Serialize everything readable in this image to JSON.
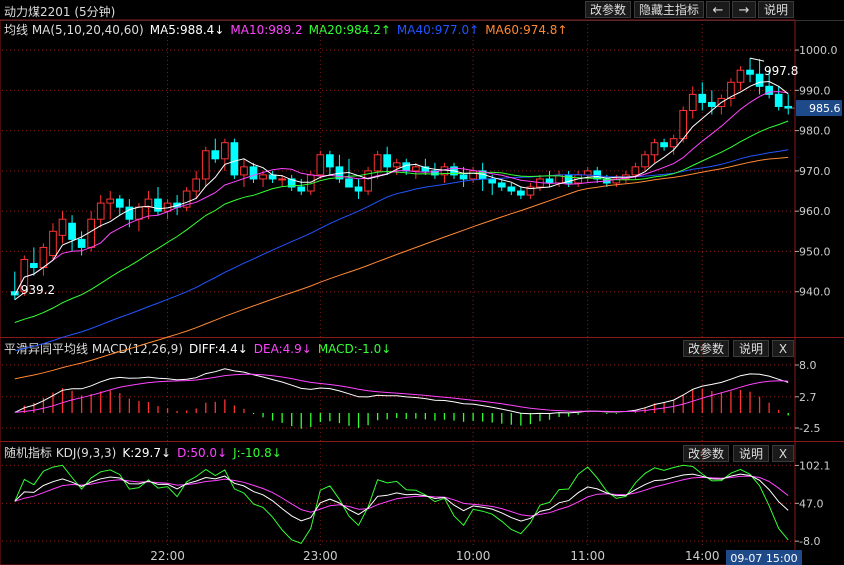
{
  "window": {
    "title": "动力煤2201 (5分钟)",
    "buttons": {
      "change_params": "改参数",
      "hide_indicator": "隐藏主指标",
      "back": "←",
      "forward": "→",
      "help": "说明",
      "close": "X"
    }
  },
  "main_legend": {
    "label": "均线 MA(5,10,20,40,60)",
    "ma5": "MA5:988.4↓",
    "ma10": "MA10:989.2",
    "ma20": "MA20:984.2↑",
    "ma40": "MA40:977.0↑",
    "ma60": "MA60:974.8↑"
  },
  "macd_legend": {
    "label": "平滑异同平均线 MACD(12,26,9)",
    "diff": "DIFF:4.4↓",
    "dea": "DEA:4.9↓",
    "macd": "MACD:-1.0↓"
  },
  "kdj_legend": {
    "label": "随机指标 KDJ(9,3,3)",
    "k": "K:29.7↓",
    "d": "D:50.0↓",
    "j": "J:-10.8↓"
  },
  "annotations": {
    "high_label": "997.8",
    "low_label": "939.2",
    "last_price": "985.6",
    "time_cursor": "09-07 15:00"
  },
  "colors": {
    "up": "#ff3232",
    "down": "#00ffff",
    "ma5": "#ffffff",
    "ma10": "#ff44ff",
    "ma20": "#33ff33",
    "ma40": "#2255ff",
    "ma60": "#ff8833",
    "grid": "#8a1a1a"
  },
  "chart_data": [
    {
      "type": "candlestick",
      "yticks": [
        1000,
        990,
        980,
        970,
        960,
        950,
        940
      ],
      "ylim": [
        929,
        1003
      ],
      "xlabels": [
        "22:00",
        "23:00",
        "10:00",
        "11:00",
        "14:00"
      ],
      "candles": [
        [
          940,
          945,
          938,
          939.2
        ],
        [
          940,
          949,
          939,
          948
        ],
        [
          947,
          951,
          944,
          946
        ],
        [
          946,
          952,
          944,
          951
        ],
        [
          949,
          957,
          948,
          955
        ],
        [
          954,
          960,
          952,
          958
        ],
        [
          957,
          959,
          950,
          953
        ],
        [
          953,
          955,
          949,
          951
        ],
        [
          951,
          960,
          950,
          958
        ],
        [
          958,
          964,
          956,
          962
        ],
        [
          962,
          965,
          958,
          963
        ],
        [
          963,
          964,
          959,
          961
        ],
        [
          961,
          963,
          956,
          958
        ],
        [
          958,
          962,
          955,
          961
        ],
        [
          961,
          965,
          958,
          963
        ],
        [
          963,
          966,
          959,
          960
        ],
        [
          960,
          963,
          958,
          962
        ],
        [
          962,
          964,
          959,
          961
        ],
        [
          961,
          966,
          960,
          965
        ],
        [
          965,
          970,
          963,
          968
        ],
        [
          968,
          976,
          966,
          975
        ],
        [
          975,
          978,
          972,
          973
        ],
        [
          973,
          978,
          970,
          977
        ],
        [
          977,
          978,
          968,
          969
        ],
        [
          969,
          973,
          966,
          971
        ],
        [
          971,
          972,
          967,
          968
        ],
        [
          968,
          970,
          966,
          969
        ],
        [
          969,
          970,
          967,
          968
        ],
        [
          968,
          969,
          966,
          968
        ],
        [
          968,
          969,
          965,
          966
        ],
        [
          966,
          968,
          964,
          965
        ],
        [
          965,
          970,
          964,
          969
        ],
        [
          969,
          975,
          968,
          974
        ],
        [
          974,
          975,
          969,
          971
        ],
        [
          971,
          974,
          967,
          968
        ],
        [
          968,
          973,
          966,
          966
        ],
        [
          966,
          968,
          963,
          965
        ],
        [
          965,
          971,
          964,
          970
        ],
        [
          970,
          975,
          968,
          974
        ],
        [
          974,
          976,
          969,
          971
        ],
        [
          971,
          973,
          969,
          972
        ],
        [
          972,
          973,
          969,
          970
        ],
        [
          970,
          972,
          968,
          971
        ],
        [
          971,
          973,
          969,
          970
        ],
        [
          970,
          972,
          968,
          969
        ],
        [
          969,
          972,
          967,
          971
        ],
        [
          971,
          972,
          968,
          969
        ],
        [
          969,
          971,
          966,
          968
        ],
        [
          968,
          971,
          967,
          970
        ],
        [
          970,
          972,
          965,
          968
        ],
        [
          968,
          969,
          964,
          967
        ],
        [
          967,
          968,
          965,
          966
        ],
        [
          966,
          967,
          964,
          965
        ],
        [
          965,
          966,
          963,
          964
        ],
        [
          964,
          967,
          963,
          966
        ],
        [
          966,
          969,
          965,
          968
        ],
        [
          968,
          970,
          966,
          967
        ],
        [
          967,
          970,
          966,
          969
        ],
        [
          969,
          970,
          966,
          967
        ],
        [
          967,
          970,
          966,
          969
        ],
        [
          969,
          971,
          967,
          970
        ],
        [
          970,
          971,
          967,
          968
        ],
        [
          968,
          969,
          966,
          967
        ],
        [
          967,
          969,
          966,
          968
        ],
        [
          968,
          970,
          967,
          969
        ],
        [
          969,
          972,
          968,
          971
        ],
        [
          971,
          975,
          970,
          974
        ],
        [
          974,
          978,
          972,
          977
        ],
        [
          977,
          978,
          975,
          976
        ],
        [
          976,
          979,
          974,
          978
        ],
        [
          978,
          986,
          977,
          985
        ],
        [
          985,
          991,
          983,
          989
        ],
        [
          989,
          992,
          985,
          987
        ],
        [
          987,
          990,
          984,
          986
        ],
        [
          986,
          989,
          984,
          988
        ],
        [
          988,
          993,
          986,
          992
        ],
        [
          992,
          996,
          990,
          995
        ],
        [
          995,
          998,
          992,
          994
        ],
        [
          994,
          997.8,
          989,
          991
        ],
        [
          991,
          995,
          988,
          989
        ],
        [
          989,
          991,
          985,
          986
        ],
        [
          986,
          989,
          984,
          985.6
        ]
      ]
    },
    {
      "type": "macd",
      "yticks": [
        8.0,
        2.7,
        -2.5
      ],
      "ylim": [
        -4.5,
        9.5
      ]
    },
    {
      "type": "kdj",
      "yticks": [
        102.1,
        47.0,
        -8.0
      ],
      "ylim": [
        -15,
        110
      ]
    }
  ]
}
